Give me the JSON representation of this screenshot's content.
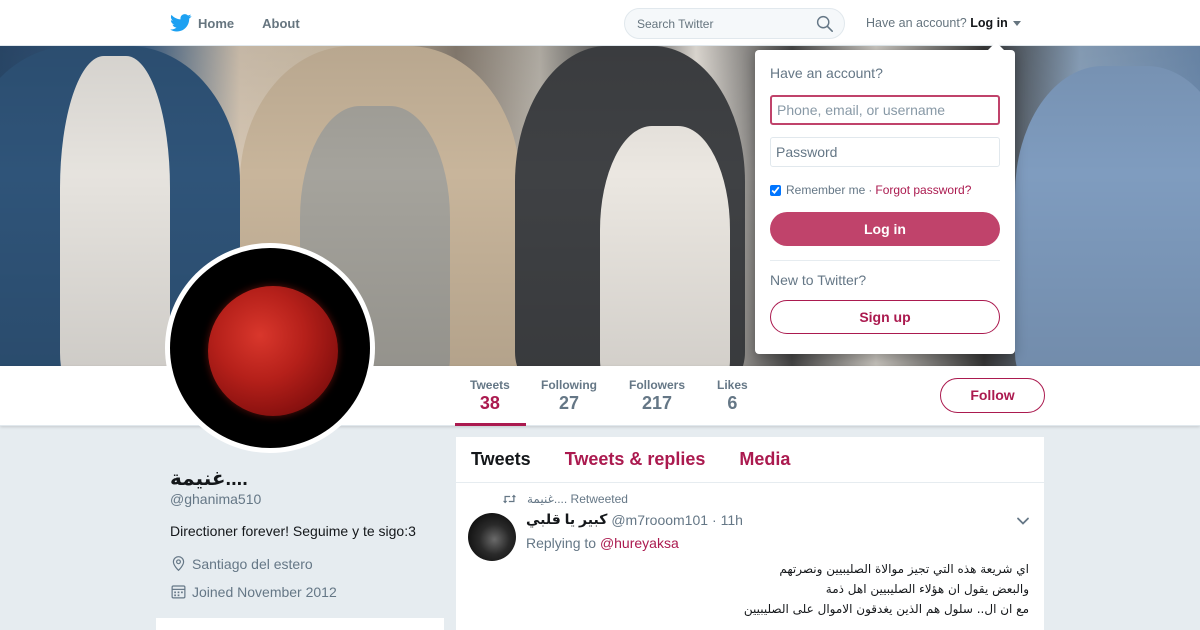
{
  "nav": {
    "home_label": "Home",
    "about_label": "About",
    "search_placeholder": "Search Twitter",
    "account_prompt": "Have an account?",
    "login_label": "Log in"
  },
  "profile": {
    "display_name": "غنيمة....",
    "handle": "@ghanima510",
    "bio": "Directioner forever! Seguime y te sigo:3",
    "location": "Santiago del estero",
    "joined": "Joined November 2012"
  },
  "stats": [
    {
      "label": "Tweets",
      "value": "38"
    },
    {
      "label": "Following",
      "value": "27"
    },
    {
      "label": "Followers",
      "value": "217"
    },
    {
      "label": "Likes",
      "value": "6"
    }
  ],
  "follow_label": "Follow",
  "timeline": {
    "tabs": [
      "Tweets",
      "Tweets & replies",
      "Media"
    ],
    "tweet": {
      "retweet_label": "غنيمة.... Retweeted",
      "author_name": "كبير يا قلبي",
      "author_handle": "@m7rooom101",
      "time": "· 11h",
      "replying_prefix": "Replying to",
      "replying_handle": "@hureyaksa",
      "text_lines": [
        "اي شريعة هذه التي تجيز موالاة الصليبيين ونصرتهم",
        "والبعض يقول ان هؤلاء الصليبيين اهل ذمة",
        "مع ان ال.. سلول هم الذين يغدقون الاموال على الصليبيين"
      ]
    }
  },
  "login_dropdown": {
    "title": "Have an account?",
    "username_placeholder": "Phone, email, or username",
    "password_placeholder": "Password",
    "remember_label": "Remember me",
    "separator": "·",
    "forgot_label": "Forgot password?",
    "login_button": "Log in",
    "new_prompt": "New to Twitter?",
    "signup_button": "Sign up"
  },
  "colors": {
    "accent": "#ab1a4f",
    "login_button": "#c0436b",
    "page_background": "#e6ecf0"
  }
}
